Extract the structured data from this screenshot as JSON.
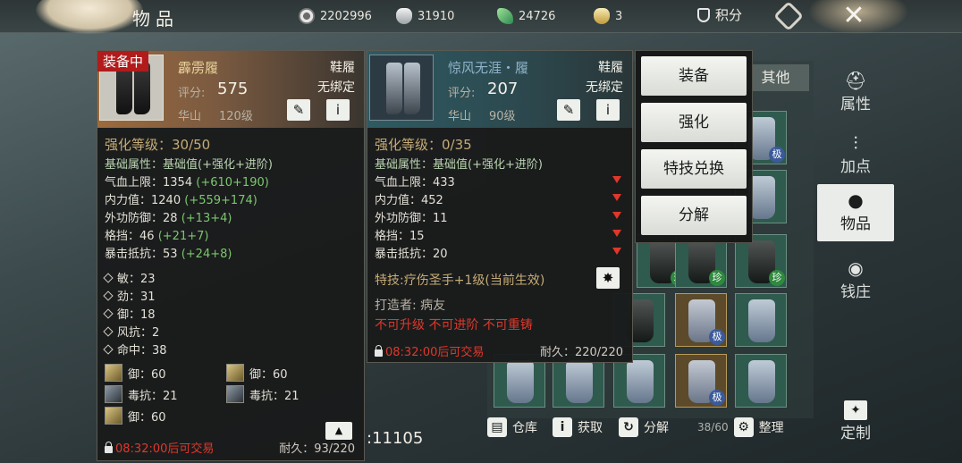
{
  "topbar": {
    "title": "物品",
    "currencies": [
      {
        "icon": "coin-wheel-icon",
        "value": "2202996"
      },
      {
        "icon": "silver-ingot-icon",
        "value": "31910"
      },
      {
        "icon": "jade-leaf-icon",
        "value": "24726"
      },
      {
        "icon": "gold-ingot-icon",
        "value": "3"
      }
    ],
    "score_label": "积分"
  },
  "nav": {
    "items": [
      {
        "label": "属性",
        "icon": "hat-icon",
        "glyph": "⛑"
      },
      {
        "label": "加点",
        "icon": "sliders-icon",
        "glyph": "⫶"
      },
      {
        "label": "物品",
        "icon": "bag-icon",
        "glyph": "●"
      },
      {
        "label": "钱庄",
        "icon": "money-pouch-icon",
        "glyph": "◉"
      }
    ],
    "active": "物品",
    "custom_label": "定制"
  },
  "inventory": {
    "tab_other": "其他",
    "money": ":11105",
    "warehouse_label": "仓库",
    "obtain_label": "获取",
    "decompose_label": "分解",
    "capacity": "38/60",
    "sort_label": "整理",
    "slot_badges": [
      "极",
      "珍"
    ]
  },
  "equipped_item": {
    "badge": "装备中",
    "name": "霹雳履",
    "name_color": "#e7d29a",
    "slot": "鞋履",
    "bind": "无绑定",
    "score_label": "评分:",
    "score": "575",
    "sect": "华山",
    "level": "120级",
    "enhance": "强化等级：30/50",
    "base_header": "基础属性：基础值(+强化+进阶)",
    "stats": [
      {
        "label": "气血上限：",
        "value": "1354",
        "bonus": "(+610+190)"
      },
      {
        "label": "内力值：",
        "value": "1240",
        "bonus": "(+559+174)"
      },
      {
        "label": "外功防御：",
        "value": "28",
        "bonus": "(+13+4)"
      },
      {
        "label": "格挡：",
        "value": "46",
        "bonus": "(+21+7)"
      },
      {
        "label": "暴击抵抗：",
        "value": "53",
        "bonus": "(+24+8)"
      }
    ],
    "extra": [
      "敏：23",
      "劲：31",
      "御：18",
      "风抗：2",
      "命中：38"
    ],
    "gems": [
      {
        "text": "御：60",
        "type": "gold"
      },
      {
        "text": "御：60",
        "type": "gold"
      },
      {
        "text": "毒抗：21",
        "type": "dark"
      },
      {
        "text": "毒抗：21",
        "type": "dark"
      },
      {
        "text": "御：60",
        "type": "gold"
      }
    ],
    "trade": "08:32:00后可交易",
    "durability": "耐久：93/220"
  },
  "compare_item": {
    "name": "惊风无涯・履",
    "name_color": "#8fb3c9",
    "slot": "鞋履",
    "bind": "无绑定",
    "score_label": "评分:",
    "score": "207",
    "sect": "华山",
    "level": "90级",
    "enhance": "强化等级：0/35",
    "base_header": "基础属性：基础值(+强化+进阶)",
    "stats": [
      {
        "label": "气血上限：",
        "value": "433"
      },
      {
        "label": "内力值：",
        "value": "452"
      },
      {
        "label": "外功防御：",
        "value": "11"
      },
      {
        "label": "格挡：",
        "value": "15"
      },
      {
        "label": "暴击抵抗：",
        "value": "20"
      }
    ],
    "skill": "特技:疗伤圣手+1级(当前生效)",
    "maker": "打造者: 病友",
    "restrictions": "不可升级 不可进阶 不可重铸",
    "trade": "08:32:00后可交易",
    "durability": "耐久：220/220"
  },
  "menu": {
    "equip": "装备",
    "enhance": "强化",
    "skill_exchange": "特技兑换",
    "decompose": "分解"
  }
}
